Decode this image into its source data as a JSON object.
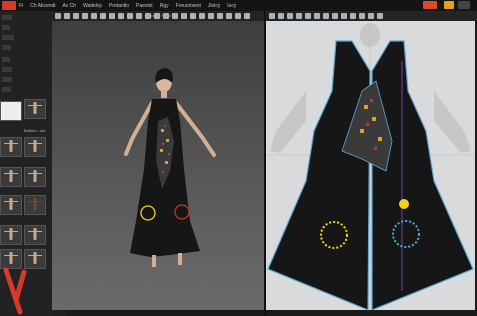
{
  "menu": {
    "items": [
      "Fi",
      "Ch Akcendi",
      "Av Ch",
      "Wadelsy",
      "Pretantlo",
      "Paevtst",
      "Rgy",
      "Freuorisent",
      "Jlnicy",
      "lucy"
    ]
  },
  "viewport3d": {
    "title": "Sketch Rend"
  },
  "left_panel": {
    "labels": [
      "Bottom...obi"
    ]
  },
  "colors": {
    "accent_red": "#d63a2a",
    "garment_black": "#161616",
    "outline_blue": "#5aa9d6",
    "accent_yellow": "#f2d21a",
    "pattern_red": "#c2372a"
  }
}
